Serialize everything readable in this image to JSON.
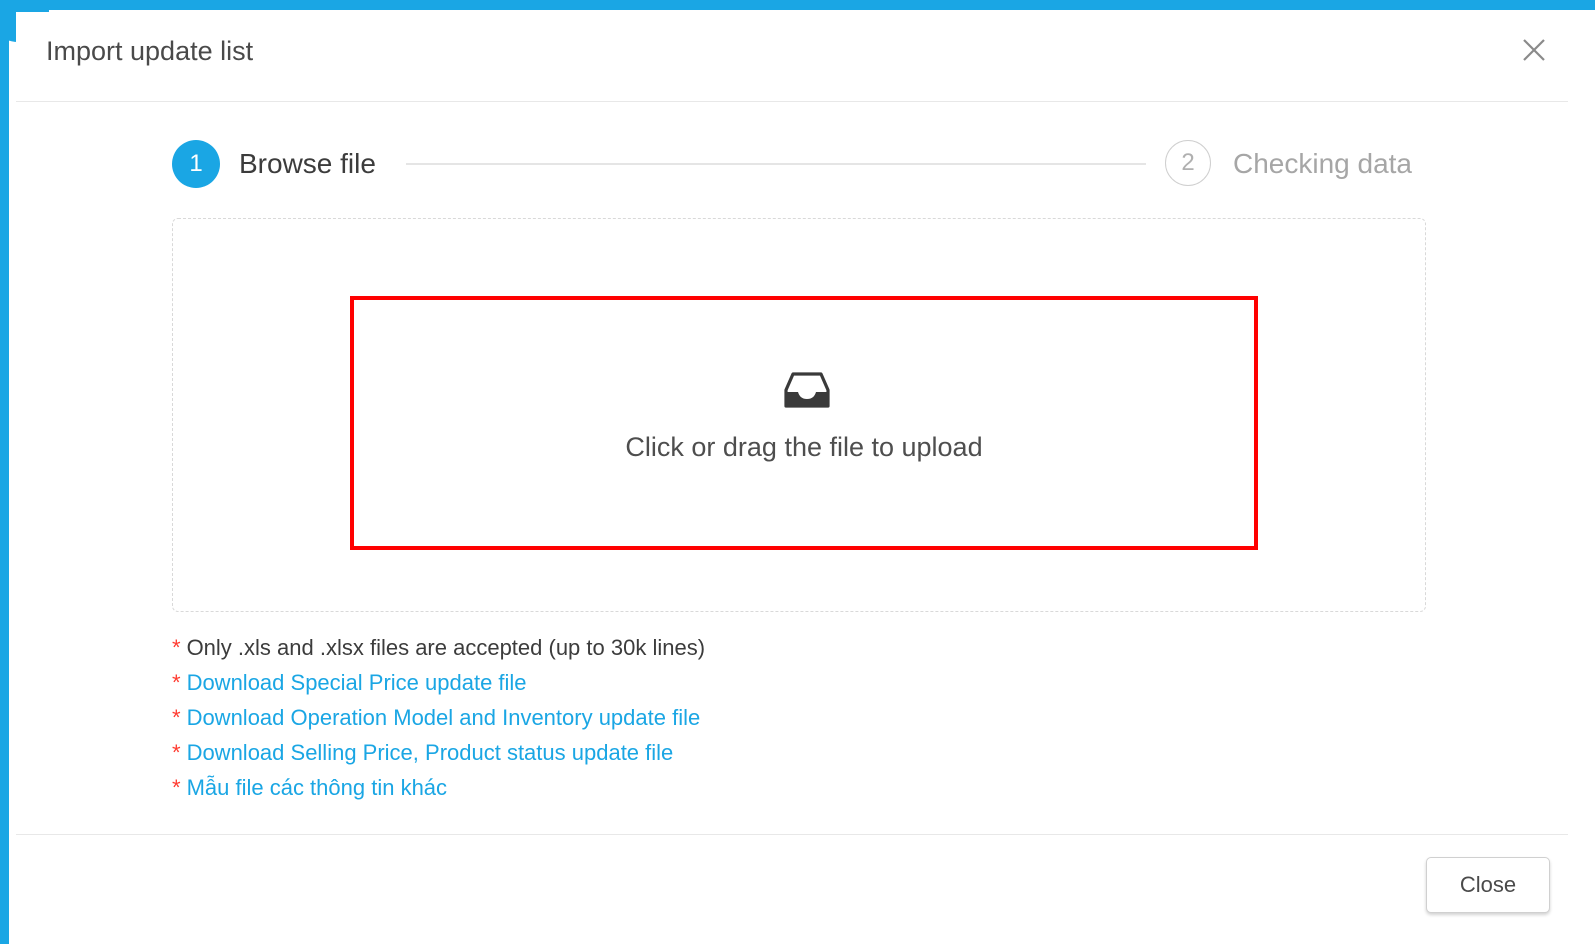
{
  "modal": {
    "title": "Import update list",
    "close_icon": "close-icon"
  },
  "steps": [
    {
      "number": "1",
      "label": "Browse file",
      "status": "active"
    },
    {
      "number": "2",
      "label": "Checking data",
      "status": "inactive"
    }
  ],
  "dropzone": {
    "icon": "inbox-icon",
    "text": "Click or drag the file to upload"
  },
  "notes": {
    "asterisk": "*",
    "accepted_files": "Only .xls and .xlsx files are accepted (up to 30k lines)",
    "links": [
      "Download Special Price update file",
      "Download Operation Model and Inventory update file",
      "Download Selling Price, Product status update file",
      "Mẫu file các thông tin khác"
    ]
  },
  "footer": {
    "close_label": "Close"
  },
  "colors": {
    "accent": "#1aa6e4",
    "highlight": "#ff0000",
    "asterisk": "#ff3b30"
  }
}
